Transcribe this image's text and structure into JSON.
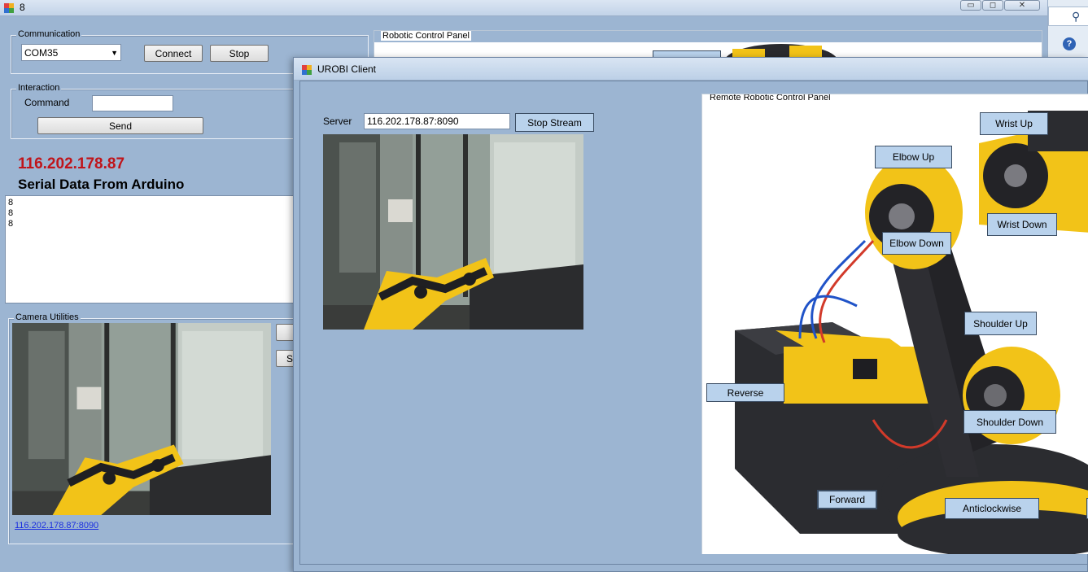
{
  "main_window": {
    "title": "8",
    "communication": {
      "legend": "Communication",
      "port_value": "COM35",
      "connect_label": "Connect",
      "stop_label": "Stop"
    },
    "interaction": {
      "legend": "Interaction",
      "command_label": "Command",
      "command_value": "",
      "send_label": "Send"
    },
    "ip_text": "116.202.178.87",
    "serial_heading": "Serial Data From Arduino",
    "serial_lines": [
      "8",
      "8",
      "8"
    ],
    "camera": {
      "legend": "Camera Utilities",
      "stream_link": "116.202.178.87:8090",
      "partial_button_label": "S"
    },
    "robotic_panel_legend": "Robotic Control Panel"
  },
  "client_window": {
    "title": "UROBI Client",
    "server_label": "Server",
    "server_value": "116.202.178.87:8090",
    "stop_stream_label": "Stop Stream",
    "remote_panel_legend": "Remote Robotic Control Panel",
    "controls": {
      "wrist_up": "Wrist Up",
      "elbow_up": "Elbow Up",
      "wrist_down": "Wrist Down",
      "elbow_down": "Elbow Down",
      "shoulder_up": "Shoulder Up",
      "reverse": "Reverse",
      "shoulder_down": "Shoulder Down",
      "forward": "Forward",
      "anticlockwise": "Anticlockwise"
    }
  },
  "colors": {
    "ip_text": "#c0141a",
    "link": "#1a2ee0",
    "robot_yellow": "#f2c318",
    "robot_dark": "#2a2a2e"
  }
}
